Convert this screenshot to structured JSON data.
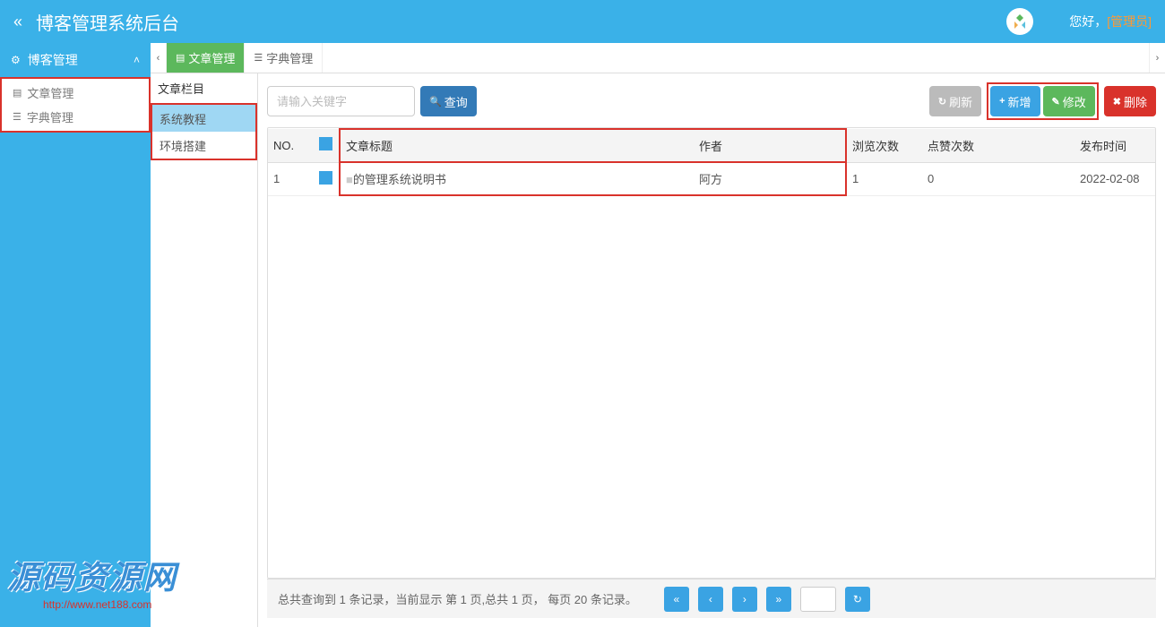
{
  "header": {
    "title": "博客管理系统后台",
    "greeting_prefix": "您好，",
    "role": "[管理员]"
  },
  "sidebar": {
    "section": {
      "label": "博客管理"
    },
    "items": [
      {
        "label": "文章管理"
      },
      {
        "label": "字典管理"
      }
    ]
  },
  "navcol": {
    "header": "文章栏目",
    "items": [
      {
        "label": "系统教程",
        "active": true
      },
      {
        "label": "环境搭建",
        "active": false
      }
    ]
  },
  "tabs": [
    {
      "label": "文章管理",
      "active": true
    },
    {
      "label": "字典管理",
      "active": false
    }
  ],
  "toolbar": {
    "search_placeholder": "请输入关键字",
    "search_btn": "查询",
    "refresh": "刷新",
    "add": "新增",
    "edit": "修改",
    "delete": "删除"
  },
  "table": {
    "headers": {
      "no": "NO.",
      "title": "文章标题",
      "author": "作者",
      "views": "浏览次数",
      "likes": "点赞次数",
      "date": "发布时间"
    },
    "rows": [
      {
        "no": "1",
        "title": "的管理系统说明书",
        "author": "阿方",
        "views": "1",
        "likes": "0",
        "date": "2022-02-08"
      }
    ]
  },
  "footer": {
    "info": "总共查询到 1 条记录，当前显示 第 1 页,总共 1 页， 每页 20 条记录。"
  },
  "watermark": {
    "text": "源码资源网",
    "url": "http://www.net188.com"
  }
}
